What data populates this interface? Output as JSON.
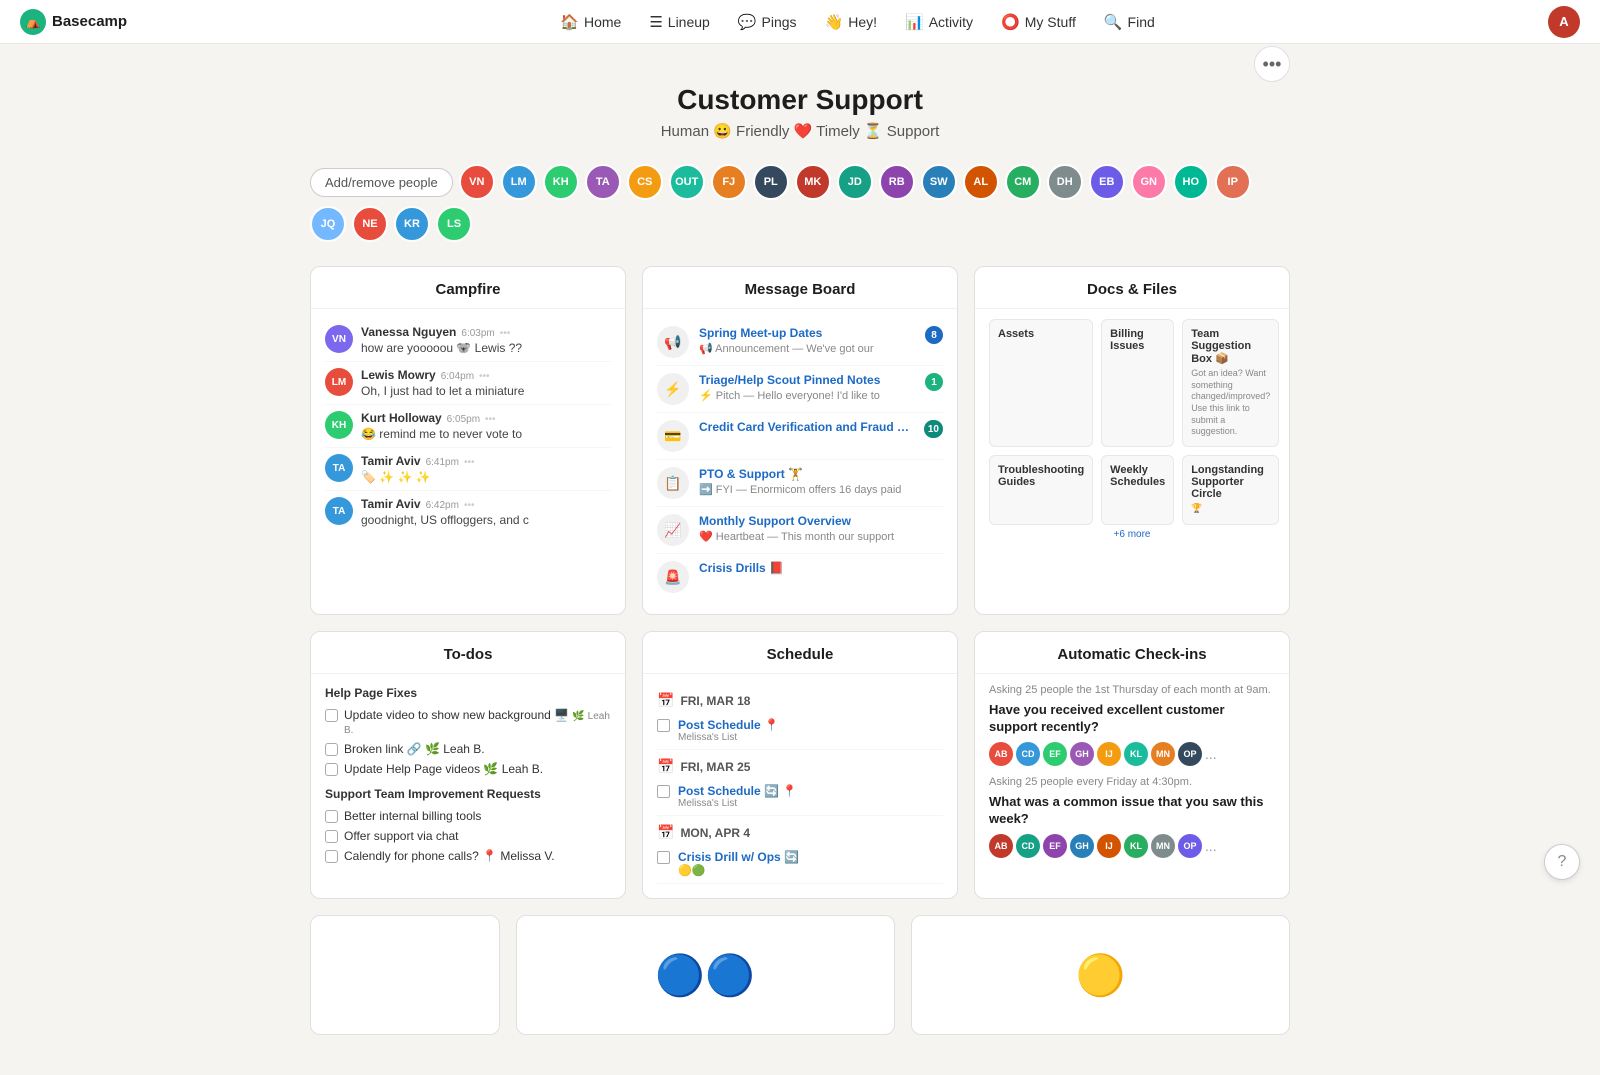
{
  "brand": {
    "name": "Basecamp",
    "logo_icon": "⛺"
  },
  "nav": {
    "links": [
      {
        "id": "home",
        "label": "Home",
        "icon": "🏠"
      },
      {
        "id": "lineup",
        "label": "Lineup",
        "icon": "☰"
      },
      {
        "id": "pings",
        "label": "Pings",
        "icon": "💬"
      },
      {
        "id": "hey",
        "label": "Hey!",
        "icon": "👋"
      },
      {
        "id": "activity",
        "label": "Activity",
        "icon": "📊"
      },
      {
        "id": "mystuff",
        "label": "My Stuff",
        "icon": "⭕"
      },
      {
        "id": "find",
        "label": "Find",
        "icon": "🔍"
      }
    ]
  },
  "project": {
    "title": "Customer Support",
    "subtitle": "Human 😀 Friendly ❤️ Timely ⏳ Support"
  },
  "people_section": {
    "add_button_label": "Add/remove people"
  },
  "three_dot_label": "•••",
  "campfire": {
    "title": "Campfire",
    "messages": [
      {
        "author": "Vanessa Nguyen",
        "time": "6:03pm",
        "text": "how are yooooou 🐨 Lewis ??",
        "color": "#7b68ee"
      },
      {
        "author": "Lewis Mowry",
        "time": "6:04pm",
        "text": "Oh, I just had to let a miniature",
        "color": "#e74c3c"
      },
      {
        "author": "Kurt Holloway",
        "time": "6:05pm",
        "text": "😂 remind me to never vote to",
        "color": "#2ecc71"
      },
      {
        "author": "Tamir Aviv",
        "time": "6:41pm",
        "text": "🏷️ ✨ ✨ ✨",
        "color": "#3498db"
      },
      {
        "author": "Tamir Aviv",
        "time": "6:42pm",
        "text": "goodnight, US offloggers, and c",
        "color": "#3498db"
      }
    ]
  },
  "message_board": {
    "title": "Message Board",
    "items": [
      {
        "title": "Spring Meet-up Dates",
        "subtitle": "📢 Announcement — We've got our",
        "badge": "8",
        "badge_type": "blue",
        "icon": "📢"
      },
      {
        "title": "Triage/Help Scout Pinned Notes",
        "subtitle": "⚡ Pitch — Hello everyone! I'd like to",
        "badge": "1",
        "badge_type": "green",
        "icon": "⚡"
      },
      {
        "title": "Credit Card Verification and Fraud Controls",
        "subtitle": "",
        "badge": "10",
        "badge_type": "teal",
        "icon": "💳"
      },
      {
        "title": "PTO & Support 🏋",
        "subtitle": "➡️ FYI — Enormicom offers 16 days paid",
        "badge": "",
        "badge_type": "",
        "icon": "📋"
      },
      {
        "title": "Monthly Support Overview",
        "subtitle": "❤️ Heartbeat — This month our support",
        "badge": "",
        "badge_type": "",
        "icon": "📈"
      },
      {
        "title": "Crisis Drills 📕",
        "subtitle": "",
        "badge": "",
        "badge_type": "blue",
        "icon": "🚨"
      }
    ]
  },
  "docs_files": {
    "title": "Docs & Files",
    "items": [
      {
        "title": "Assets",
        "preview": ""
      },
      {
        "title": "Billing Issues",
        "preview": ""
      },
      {
        "title": "Team Suggestion Box 📦",
        "preview": "Got an idea? Want something changed/improved? Use this link to submit a suggestion."
      },
      {
        "title": "Troubleshooting Guides",
        "preview": ""
      },
      {
        "title": "Weekly Schedules",
        "preview": ""
      },
      {
        "title": "Longstanding Supporter Circle",
        "preview": "🏆",
        "more": "+6 more"
      }
    ]
  },
  "todos": {
    "title": "To-dos",
    "sections": [
      {
        "title": "Help Page Fixes",
        "items": [
          {
            "text": "Update video to show new background 🖥️",
            "assignee": "🌿 Leah B."
          },
          {
            "text": "Broken link 🔗 🌿 Leah B.",
            "assignee": ""
          },
          {
            "text": "Update Help Page videos 🌿 Leah B.",
            "assignee": ""
          }
        ]
      },
      {
        "title": "Support Team Improvement Requests",
        "items": [
          {
            "text": "Better internal billing tools",
            "assignee": ""
          },
          {
            "text": "Offer support via chat",
            "assignee": ""
          },
          {
            "text": "Calendly for phone calls? 📍 Melissa V.",
            "assignee": ""
          }
        ]
      }
    ]
  },
  "schedule": {
    "title": "Schedule",
    "dates": [
      {
        "label": "FRI, MAR 18",
        "events": [
          {
            "title": "Post Schedule 📍",
            "sub": "Melissa's List",
            "icons": ""
          }
        ]
      },
      {
        "label": "FRI, MAR 25",
        "events": [
          {
            "title": "Post Schedule 🔄 📍",
            "sub": "Melissa's List",
            "icons": ""
          }
        ]
      },
      {
        "label": "MON, APR 4",
        "events": [
          {
            "title": "Crisis Drill w/ Ops 🔄",
            "sub": "",
            "icons": "🟡🟢"
          }
        ]
      }
    ]
  },
  "checkins": {
    "title": "Automatic Check-ins",
    "meta1": "Asking 25 people the 1st Thursday of each month at 9am.",
    "question1": "Have you received excellent customer support recently?",
    "meta2": "Asking 25 people every Friday at 4:30pm.",
    "question2": "What was a common issue that you saw this week?"
  },
  "avatar_colors": [
    "#e74c3c",
    "#3498db",
    "#2ecc71",
    "#9b59b6",
    "#f39c12",
    "#1abc9c",
    "#e67e22",
    "#34495e",
    "#c0392b",
    "#16a085",
    "#8e44ad",
    "#2980b9",
    "#d35400",
    "#27ae60",
    "#7f8c8d",
    "#6c5ce7",
    "#fd79a8",
    "#00b894",
    "#e17055",
    "#74b9ff"
  ]
}
